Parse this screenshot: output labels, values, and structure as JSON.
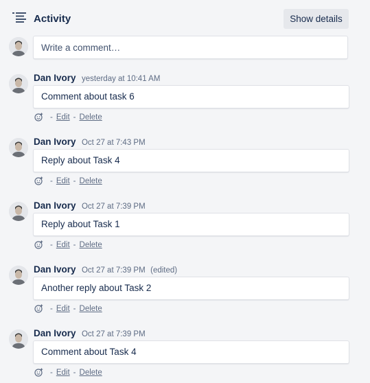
{
  "header": {
    "icon": "activity-list-icon",
    "title": "Activity",
    "show_details_label": "Show details"
  },
  "new_comment": {
    "placeholder": "Write a comment…"
  },
  "comments": [
    {
      "author": "Dan Ivory",
      "time": "yesterday at 10:41 AM",
      "edited": "",
      "text": "Comment about task 6",
      "edit_label": "Edit",
      "delete_label": "Delete"
    },
    {
      "author": "Dan Ivory",
      "time": "Oct 27 at 7:43 PM",
      "edited": "",
      "text": "Reply about Task 4",
      "edit_label": "Edit",
      "delete_label": "Delete"
    },
    {
      "author": "Dan Ivory",
      "time": "Oct 27 at 7:39 PM",
      "edited": "",
      "text": "Reply about Task 1",
      "edit_label": "Edit",
      "delete_label": "Delete"
    },
    {
      "author": "Dan Ivory",
      "time": "Oct 27 at 7:39 PM",
      "edited": "(edited)",
      "text": "Another reply about Task 2",
      "edit_label": "Edit",
      "delete_label": "Delete"
    },
    {
      "author": "Dan Ivory",
      "time": "Oct 27 at 7:39 PM",
      "edited": "",
      "text": "Comment about Task 4",
      "edit_label": "Edit",
      "delete_label": "Delete"
    }
  ],
  "separator": "-",
  "icons": {
    "avatar": "user-avatar",
    "reaction": "add-reaction-icon"
  },
  "colors": {
    "background": "#f4f5f7",
    "text": "#172b4d",
    "muted": "#5e6c84",
    "button": "#e6e8ec"
  }
}
